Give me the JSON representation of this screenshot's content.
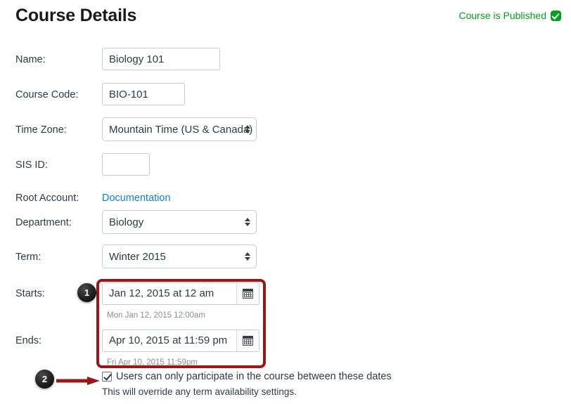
{
  "header": {
    "title": "Course Details",
    "publish_status": "Course is Published",
    "publish_icon": "published-check-icon",
    "publish_color": "#00a11b"
  },
  "form": {
    "name": {
      "label": "Name:",
      "value": "Biology 101"
    },
    "course_code": {
      "label": "Course Code:",
      "value": "BIO-101"
    },
    "time_zone": {
      "label": "Time Zone:",
      "value": "Mountain Time (US & Canada)"
    },
    "sis_id": {
      "label": "SIS ID:",
      "value": ""
    },
    "root_account": {
      "label": "Root Account:",
      "value": "Documentation"
    },
    "department": {
      "label": "Department:",
      "value": "Biology"
    },
    "term": {
      "label": "Term:",
      "value": "Winter 2015"
    },
    "starts": {
      "label": "Starts:",
      "value": "Jan 12, 2015 at 12 am",
      "hint": "Mon Jan 12, 2015 12:00am",
      "calendar_icon": "calendar-icon"
    },
    "ends": {
      "label": "Ends:",
      "value": "Apr 10, 2015 at 11:59 pm",
      "hint": "Fri Apr 10, 2015 11:59pm",
      "calendar_icon": "calendar-icon"
    },
    "restrict_participation": {
      "label": "Users can only participate in the course between these dates",
      "sub_label": "This will override any term availability settings.",
      "checked": true
    }
  },
  "annotations": {
    "box_color": "#9b1717",
    "badge_1": "1",
    "badge_2": "2"
  }
}
